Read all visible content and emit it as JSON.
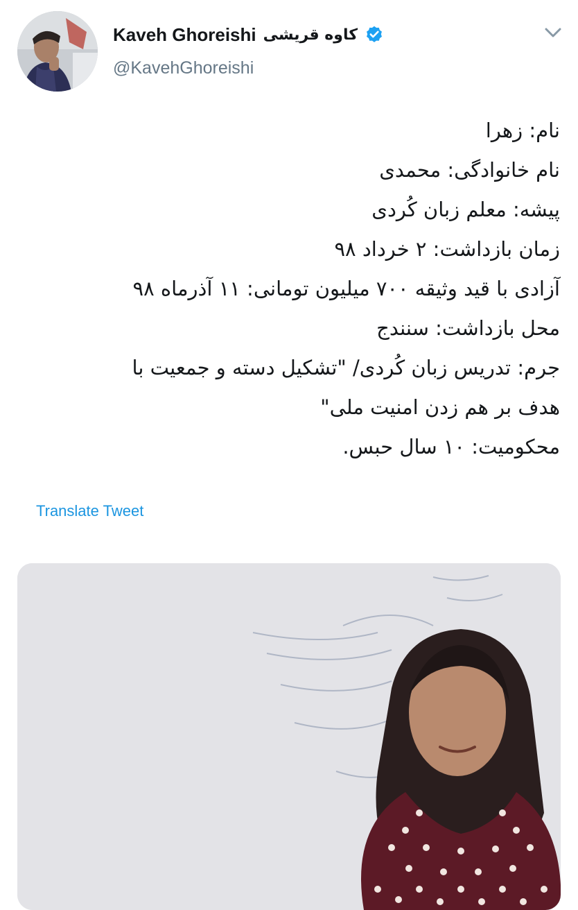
{
  "author": {
    "display_name": "Kaveh Ghoreishi",
    "display_name_fa": "کاوه قریشی",
    "handle": "@KavehGhoreishi",
    "verified": true,
    "avatar_icon": "user-avatar-photo",
    "verified_icon": "verified-badge-icon"
  },
  "menu": {
    "icon": "chevron-down-icon"
  },
  "tweet": {
    "lines": [
      "نام: زهرا",
      "نام خانوادگی: محمدی",
      "پیشه: معلم زبان کُردی",
      "زمان بازداشت: ۲ خرداد ۹۸",
      "آزادی با قید وثیقه ۷۰۰ میلیون تومانی: ۱۱ آذرماه ۹۸",
      "محل بازداشت: سنندج",
      "جرم: تدریس زبان کُردی/ \"تشکیل دسته و جمعیت با",
      "هدف بر هم زدن امنیت ملی\"",
      "محکومیت:  ۱۰ سال حبس."
    ],
    "translate_label": "Translate Tweet"
  },
  "media": {
    "type": "photo",
    "subject": "woman-in-headscarf-photo"
  },
  "colors": {
    "text": "#14171a",
    "secondary": "#657786",
    "link": "#1b95e0",
    "verified": "#1da1f2"
  }
}
